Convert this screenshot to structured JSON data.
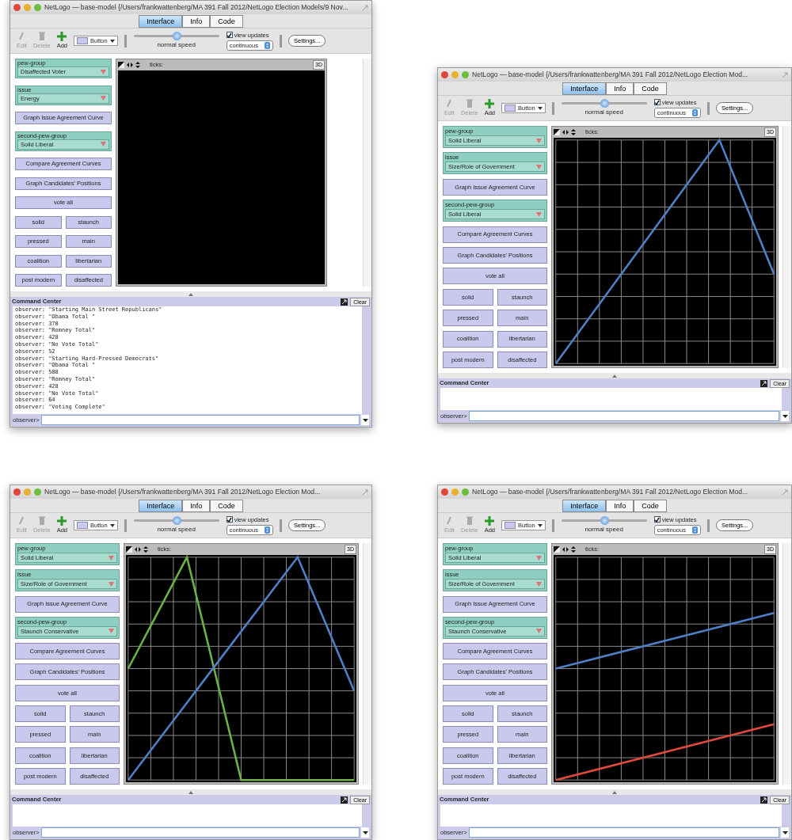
{
  "windows": [
    {
      "title": "NetLogo — base-model {/Users/frankwattenberg/MA 391 Fall 2012/NetLogo Election Models/9 Nov...",
      "tabs": [
        {
          "label": "Interface",
          "selected": true
        },
        {
          "label": "Info",
          "selected": false
        },
        {
          "label": "Code",
          "selected": false
        }
      ],
      "toolbar": {
        "tools": [
          {
            "kind": "edit",
            "label": "Edit",
            "disabled": true
          },
          {
            "kind": "delete",
            "label": "Delete",
            "disabled": true
          },
          {
            "kind": "add",
            "label": "Add",
            "disabled": false
          }
        ],
        "widget_type": "Button",
        "speed": {
          "label": "normal speed",
          "level": 0.5
        },
        "view_updates": {
          "label": "view updates",
          "checked": true
        },
        "update_mode": "continuous",
        "settings": "Settings..."
      },
      "widgets": [
        {
          "kind": "chooser",
          "label": "pew-group",
          "value": "Disaffected Voter"
        },
        {
          "kind": "chooser",
          "label": "issue",
          "value": "Energy"
        },
        {
          "kind": "wide_button",
          "label": "Graph Issue Agreement Curve"
        },
        {
          "kind": "chooser",
          "label": "second-pew-group",
          "value": "Solid Liberal"
        },
        {
          "kind": "wide_button",
          "label": "Compare Agreement Curves"
        },
        {
          "kind": "wide_button",
          "label": "Graph Candidates' Positions"
        },
        {
          "kind": "wide_button",
          "label": "vote all"
        },
        {
          "kind": "button",
          "label": "solid"
        },
        {
          "kind": "button",
          "label": "staunch"
        },
        {
          "kind": "button",
          "label": "pressed"
        },
        {
          "kind": "button",
          "label": "main"
        },
        {
          "kind": "button",
          "label": "coalition"
        },
        {
          "kind": "button",
          "label": "libertarian"
        },
        {
          "kind": "button",
          "label": "post modern"
        },
        {
          "kind": "button",
          "label": "disaffected"
        }
      ],
      "view": {
        "ticks_label": "ticks:",
        "three_d": "3D",
        "grid": false
      },
      "command_center": {
        "title": "Command Center",
        "clear": "Clear",
        "prompt": "observer>",
        "output": [
          "observer: \"Starting Main Street Republicans\"",
          "observer: \"Obama Total \"",
          "observer: 370",
          "observer: \"Romney Total\"",
          "observer: 428",
          "observer: \"No Vote Total\"",
          "observer: 52",
          "observer: \"Starting Hard-Pressed Democrats\"",
          "observer: \"Obama Total \"",
          "observer: 508",
          "observer: \"Romney Total\"",
          "observer: 428",
          "observer: \"No Vote Total\"",
          "observer: 64",
          "observer: \"Voting Complete\""
        ]
      }
    },
    {
      "title": "NetLogo — base-model {/Users/frankwattenberg/MA 391 Fall 2012/NetLogo Election Mod...",
      "tabs": [
        {
          "label": "Interface",
          "selected": true
        },
        {
          "label": "Info",
          "selected": false
        },
        {
          "label": "Code",
          "selected": false
        }
      ],
      "toolbar": {
        "tools": [
          {
            "kind": "edit",
            "label": "Edit",
            "disabled": true
          },
          {
            "kind": "delete",
            "label": "Delete",
            "disabled": true
          },
          {
            "kind": "add",
            "label": "Add",
            "disabled": false
          }
        ],
        "widget_type": "Button",
        "speed": {
          "label": "normal speed",
          "level": 0.5
        },
        "view_updates": {
          "label": "view updates",
          "checked": true
        },
        "update_mode": "continuous",
        "settings": "Settings..."
      },
      "widgets": [
        {
          "kind": "chooser",
          "label": "pew-group",
          "value": "Solid Liberal"
        },
        {
          "kind": "chooser",
          "label": "issue",
          "value": "Size/Role of Government"
        },
        {
          "kind": "wide_button",
          "label": "Graph Issue Agreement Curve"
        },
        {
          "kind": "chooser",
          "label": "second-pew-group",
          "value": "Solid Liberal"
        },
        {
          "kind": "wide_button",
          "label": "Compare Agreement Curves"
        },
        {
          "kind": "wide_button",
          "label": "Graph Candidates' Positions"
        },
        {
          "kind": "wide_button",
          "label": "vote all"
        },
        {
          "kind": "button",
          "label": "solid"
        },
        {
          "kind": "button",
          "label": "staunch"
        },
        {
          "kind": "button",
          "label": "pressed"
        },
        {
          "kind": "button",
          "label": "main"
        },
        {
          "kind": "button",
          "label": "coalition"
        },
        {
          "kind": "button",
          "label": "libertarian"
        },
        {
          "kind": "button",
          "label": "post modern"
        },
        {
          "kind": "button",
          "label": "disaffected"
        }
      ],
      "view": {
        "ticks_label": "ticks:",
        "three_d": "3D",
        "grid": true,
        "traces": [
          {
            "color": "#4f7fc4"
          }
        ]
      },
      "command_center": {
        "title": "Command Center",
        "clear": "Clear",
        "prompt": "observer>"
      }
    },
    {
      "title": "NetLogo — base-model {/Users/frankwattenberg/MA 391 Fall 2012/NetLogo Election Mod...",
      "tabs": [
        {
          "label": "Interface",
          "selected": true
        },
        {
          "label": "Info",
          "selected": false
        },
        {
          "label": "Code",
          "selected": false
        }
      ],
      "toolbar": {
        "tools": [
          {
            "kind": "edit",
            "label": "Edit",
            "disabled": true
          },
          {
            "kind": "delete",
            "label": "Delete",
            "disabled": true
          },
          {
            "kind": "add",
            "label": "Add",
            "disabled": false
          }
        ],
        "widget_type": "Button",
        "speed": {
          "label": "normal speed",
          "level": 0.5
        },
        "view_updates": {
          "label": "view updates",
          "checked": true
        },
        "update_mode": "continuous",
        "settings": "Settings..."
      },
      "widgets": [
        {
          "kind": "chooser",
          "label": "pew-group",
          "value": "Solid Liberal"
        },
        {
          "kind": "chooser",
          "label": "issue",
          "value": "Size/Role of Government"
        },
        {
          "kind": "wide_button",
          "label": "Graph Issue Agreement Curve"
        },
        {
          "kind": "chooser",
          "label": "second-pew-group",
          "value": "Staunch Conservative"
        },
        {
          "kind": "wide_button",
          "label": "Compare Agreement Curves"
        },
        {
          "kind": "wide_button",
          "label": "Graph Candidates' Positions"
        },
        {
          "kind": "wide_button",
          "label": "vote all"
        },
        {
          "kind": "button",
          "label": "solid"
        },
        {
          "kind": "button",
          "label": "staunch"
        },
        {
          "kind": "button",
          "label": "pressed"
        },
        {
          "kind": "button",
          "label": "main"
        },
        {
          "kind": "button",
          "label": "coalition"
        },
        {
          "kind": "button",
          "label": "libertarian"
        },
        {
          "kind": "button",
          "label": "post modern"
        },
        {
          "kind": "button",
          "label": "disaffected"
        }
      ],
      "view": {
        "ticks_label": "ticks:",
        "three_d": "3D",
        "grid": true,
        "traces": [
          {
            "color": "#6cb048"
          },
          {
            "color": "#4f7fc4"
          }
        ]
      },
      "command_center": {
        "title": "Command Center",
        "clear": "Clear",
        "prompt": "observer>"
      }
    },
    {
      "title": "NetLogo — base-model {/Users/frankwattenberg/MA 391 Fall 2012/NetLogo Election Mod...",
      "tabs": [
        {
          "label": "Interface",
          "selected": true
        },
        {
          "label": "Info",
          "selected": false
        },
        {
          "label": "Code",
          "selected": false
        }
      ],
      "toolbar": {
        "tools": [
          {
            "kind": "edit",
            "label": "Edit",
            "disabled": true
          },
          {
            "kind": "delete",
            "label": "Delete",
            "disabled": true
          },
          {
            "kind": "add",
            "label": "Add",
            "disabled": false
          }
        ],
        "widget_type": "Button",
        "speed": {
          "label": "normal speed",
          "level": 0.5
        },
        "view_updates": {
          "label": "view updates",
          "checked": true
        },
        "update_mode": "continuous",
        "settings": "Settings..."
      },
      "widgets": [
        {
          "kind": "chooser",
          "label": "pew-group",
          "value": "Solid Liberal"
        },
        {
          "kind": "chooser",
          "label": "issue",
          "value": "Size/Role of Government"
        },
        {
          "kind": "wide_button",
          "label": "Graph Issue Agreement Curve"
        },
        {
          "kind": "chooser",
          "label": "second-pew-group",
          "value": "Staunch Conservative"
        },
        {
          "kind": "wide_button",
          "label": "Compare Agreement Curves"
        },
        {
          "kind": "wide_button",
          "label": "Graph Candidates' Positions"
        },
        {
          "kind": "wide_button",
          "label": "vote all"
        },
        {
          "kind": "button",
          "label": "solid"
        },
        {
          "kind": "button",
          "label": "staunch"
        },
        {
          "kind": "button",
          "label": "pressed"
        },
        {
          "kind": "button",
          "label": "main"
        },
        {
          "kind": "button",
          "label": "coalition"
        },
        {
          "kind": "button",
          "label": "libertarian"
        },
        {
          "kind": "button",
          "label": "post modern"
        },
        {
          "kind": "button",
          "label": "disaffected"
        }
      ],
      "view": {
        "ticks_label": "ticks:",
        "three_d": "3D",
        "grid": true,
        "traces": [
          {
            "color": "#4f7fc4"
          },
          {
            "color": "#e04a3c"
          }
        ]
      },
      "command_center": {
        "title": "Command Center",
        "clear": "Clear",
        "prompt": "observer>"
      }
    }
  ]
}
